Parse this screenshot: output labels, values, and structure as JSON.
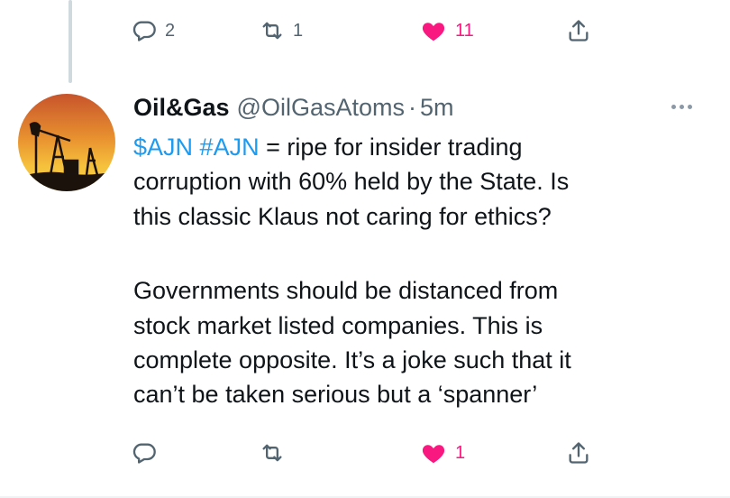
{
  "prev_tweet_actions": {
    "reply_count": "2",
    "retweet_count": "1",
    "like_count": "11"
  },
  "tweet": {
    "display_name": "Oil&Gas",
    "handle": "@OilGasAtoms",
    "separator": "·",
    "time": "5m",
    "avatar_icon": "oil-pumpjack-sunset-avatar",
    "text": {
      "cashtag": "$AJN",
      "hashtag": "#AJN",
      "line1_rest": " = ripe for insider trading",
      "line2": "corruption with 60% held by the State. Is",
      "line3": "this classic Klaus not caring for ethics?",
      "line4": "Governments should be distanced from",
      "line5": "stock market listed companies. This is",
      "line6": "complete opposite. It’s a joke such that it",
      "line7": "can’t be taken serious but a ‘spanner’"
    },
    "actions": {
      "reply_count": "",
      "retweet_count": "",
      "like_count": "1"
    }
  },
  "colors": {
    "accent": "#1d9bf0",
    "like": "#f91880",
    "muted": "#536471"
  }
}
